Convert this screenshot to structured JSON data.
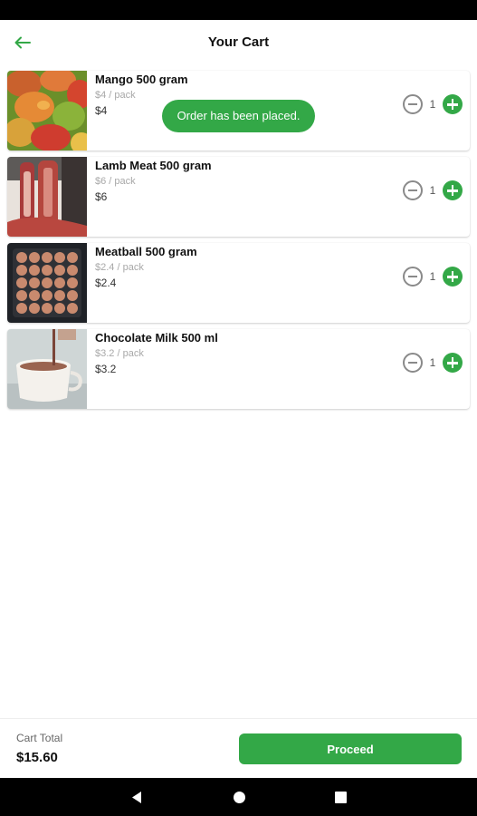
{
  "header": {
    "title": "Your Cart",
    "back_icon": "arrow-left-icon",
    "accent": "#33a847"
  },
  "toast": {
    "message": "Order has been placed."
  },
  "cart": {
    "items": [
      {
        "name": "Mango 500 gram",
        "unit_price": "$4 / pack",
        "price": "$4",
        "qty": "1"
      },
      {
        "name": "Lamb Meat 500 gram",
        "unit_price": "$6 / pack",
        "price": "$6",
        "qty": "1"
      },
      {
        "name": "Meatball 500 gram",
        "unit_price": "$2.4 / pack",
        "price": "$2.4",
        "qty": "1"
      },
      {
        "name": "Chocolate Milk 500 ml",
        "unit_price": "$3.2 / pack",
        "price": "$3.2",
        "qty": "1"
      }
    ]
  },
  "footer": {
    "total_label": "Cart Total",
    "total_value": "$15.60",
    "proceed_label": "Proceed"
  },
  "colors": {
    "brand": "#33a847",
    "muted": "#a8a8a8"
  }
}
